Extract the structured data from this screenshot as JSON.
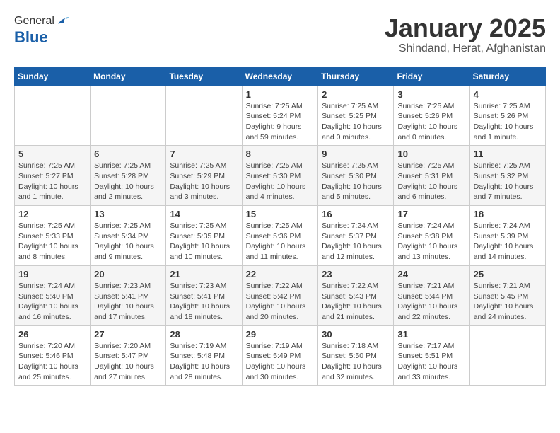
{
  "header": {
    "logo_general": "General",
    "logo_blue": "Blue",
    "title": "January 2025",
    "subtitle": "Shindand, Herat, Afghanistan"
  },
  "calendar": {
    "days_of_week": [
      "Sunday",
      "Monday",
      "Tuesday",
      "Wednesday",
      "Thursday",
      "Friday",
      "Saturday"
    ],
    "weeks": [
      [
        {
          "day": "",
          "info": ""
        },
        {
          "day": "",
          "info": ""
        },
        {
          "day": "",
          "info": ""
        },
        {
          "day": "1",
          "info": "Sunrise: 7:25 AM\nSunset: 5:24 PM\nDaylight: 9 hours and 59 minutes."
        },
        {
          "day": "2",
          "info": "Sunrise: 7:25 AM\nSunset: 5:25 PM\nDaylight: 10 hours and 0 minutes."
        },
        {
          "day": "3",
          "info": "Sunrise: 7:25 AM\nSunset: 5:26 PM\nDaylight: 10 hours and 0 minutes."
        },
        {
          "day": "4",
          "info": "Sunrise: 7:25 AM\nSunset: 5:26 PM\nDaylight: 10 hours and 1 minute."
        }
      ],
      [
        {
          "day": "5",
          "info": "Sunrise: 7:25 AM\nSunset: 5:27 PM\nDaylight: 10 hours and 1 minute."
        },
        {
          "day": "6",
          "info": "Sunrise: 7:25 AM\nSunset: 5:28 PM\nDaylight: 10 hours and 2 minutes."
        },
        {
          "day": "7",
          "info": "Sunrise: 7:25 AM\nSunset: 5:29 PM\nDaylight: 10 hours and 3 minutes."
        },
        {
          "day": "8",
          "info": "Sunrise: 7:25 AM\nSunset: 5:30 PM\nDaylight: 10 hours and 4 minutes."
        },
        {
          "day": "9",
          "info": "Sunrise: 7:25 AM\nSunset: 5:30 PM\nDaylight: 10 hours and 5 minutes."
        },
        {
          "day": "10",
          "info": "Sunrise: 7:25 AM\nSunset: 5:31 PM\nDaylight: 10 hours and 6 minutes."
        },
        {
          "day": "11",
          "info": "Sunrise: 7:25 AM\nSunset: 5:32 PM\nDaylight: 10 hours and 7 minutes."
        }
      ],
      [
        {
          "day": "12",
          "info": "Sunrise: 7:25 AM\nSunset: 5:33 PM\nDaylight: 10 hours and 8 minutes."
        },
        {
          "day": "13",
          "info": "Sunrise: 7:25 AM\nSunset: 5:34 PM\nDaylight: 10 hours and 9 minutes."
        },
        {
          "day": "14",
          "info": "Sunrise: 7:25 AM\nSunset: 5:35 PM\nDaylight: 10 hours and 10 minutes."
        },
        {
          "day": "15",
          "info": "Sunrise: 7:25 AM\nSunset: 5:36 PM\nDaylight: 10 hours and 11 minutes."
        },
        {
          "day": "16",
          "info": "Sunrise: 7:24 AM\nSunset: 5:37 PM\nDaylight: 10 hours and 12 minutes."
        },
        {
          "day": "17",
          "info": "Sunrise: 7:24 AM\nSunset: 5:38 PM\nDaylight: 10 hours and 13 minutes."
        },
        {
          "day": "18",
          "info": "Sunrise: 7:24 AM\nSunset: 5:39 PM\nDaylight: 10 hours and 14 minutes."
        }
      ],
      [
        {
          "day": "19",
          "info": "Sunrise: 7:24 AM\nSunset: 5:40 PM\nDaylight: 10 hours and 16 minutes."
        },
        {
          "day": "20",
          "info": "Sunrise: 7:23 AM\nSunset: 5:41 PM\nDaylight: 10 hours and 17 minutes."
        },
        {
          "day": "21",
          "info": "Sunrise: 7:23 AM\nSunset: 5:41 PM\nDaylight: 10 hours and 18 minutes."
        },
        {
          "day": "22",
          "info": "Sunrise: 7:22 AM\nSunset: 5:42 PM\nDaylight: 10 hours and 20 minutes."
        },
        {
          "day": "23",
          "info": "Sunrise: 7:22 AM\nSunset: 5:43 PM\nDaylight: 10 hours and 21 minutes."
        },
        {
          "day": "24",
          "info": "Sunrise: 7:21 AM\nSunset: 5:44 PM\nDaylight: 10 hours and 22 minutes."
        },
        {
          "day": "25",
          "info": "Sunrise: 7:21 AM\nSunset: 5:45 PM\nDaylight: 10 hours and 24 minutes."
        }
      ],
      [
        {
          "day": "26",
          "info": "Sunrise: 7:20 AM\nSunset: 5:46 PM\nDaylight: 10 hours and 25 minutes."
        },
        {
          "day": "27",
          "info": "Sunrise: 7:20 AM\nSunset: 5:47 PM\nDaylight: 10 hours and 27 minutes."
        },
        {
          "day": "28",
          "info": "Sunrise: 7:19 AM\nSunset: 5:48 PM\nDaylight: 10 hours and 28 minutes."
        },
        {
          "day": "29",
          "info": "Sunrise: 7:19 AM\nSunset: 5:49 PM\nDaylight: 10 hours and 30 minutes."
        },
        {
          "day": "30",
          "info": "Sunrise: 7:18 AM\nSunset: 5:50 PM\nDaylight: 10 hours and 32 minutes."
        },
        {
          "day": "31",
          "info": "Sunrise: 7:17 AM\nSunset: 5:51 PM\nDaylight: 10 hours and 33 minutes."
        },
        {
          "day": "",
          "info": ""
        }
      ]
    ]
  }
}
